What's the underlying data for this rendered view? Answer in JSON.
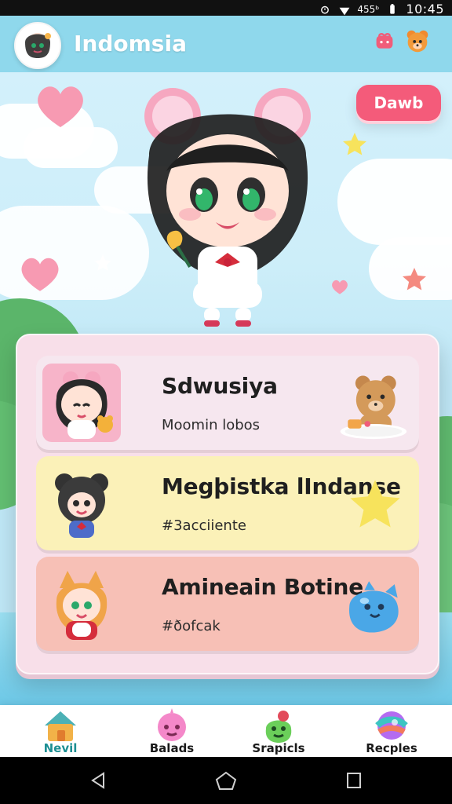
{
  "status_bar": {
    "battery_text": "455ᵇ",
    "time": "10:45"
  },
  "header": {
    "title": "Indomsia",
    "avatar_icon": "chibi-avatar-icon",
    "actions": [
      {
        "icon": "gift-heart-icon"
      },
      {
        "icon": "bear-face-icon"
      }
    ]
  },
  "hero": {
    "button_label": "Dawb",
    "character_icon": "chibi-girl-with-buns"
  },
  "cards": [
    {
      "title": "Sdwusiya",
      "subtitle": "Moomin lobos",
      "bg": "#f6e7ef",
      "thumb_bg": "#f7b4c9",
      "thumb_icon": "chibi-girl-bear-icon",
      "side_icon": "bear-with-tray-icon"
    },
    {
      "title": "Megþistka lIndanse",
      "subtitle": "#3acciiente",
      "bg": "#fbf1b8",
      "thumb_bg": "#fbf1b8",
      "thumb_icon": "chibi-bear-girl-icon",
      "side_icon": "star-icon"
    },
    {
      "title": "Amineain Botine",
      "subtitle": "#ðofcak",
      "bg": "#f7c0b6",
      "thumb_bg": "#f7c0b6",
      "thumb_icon": "chibi-cat-girl-icon",
      "side_icon": "blue-slime-cat-icon"
    }
  ],
  "bottom_nav": {
    "items": [
      {
        "label": "Nevil",
        "icon": "home-icon",
        "active": true
      },
      {
        "label": "Balads",
        "icon": "pink-creature-icon",
        "active": false
      },
      {
        "label": "Srapicls",
        "icon": "green-creature-icon",
        "active": false
      },
      {
        "label": "Recples",
        "icon": "colorful-ball-icon",
        "active": false
      }
    ]
  },
  "colors": {
    "header": "#8fd8ec",
    "accent_button": "#f45b7a",
    "active_nav": "#1d8f93"
  }
}
